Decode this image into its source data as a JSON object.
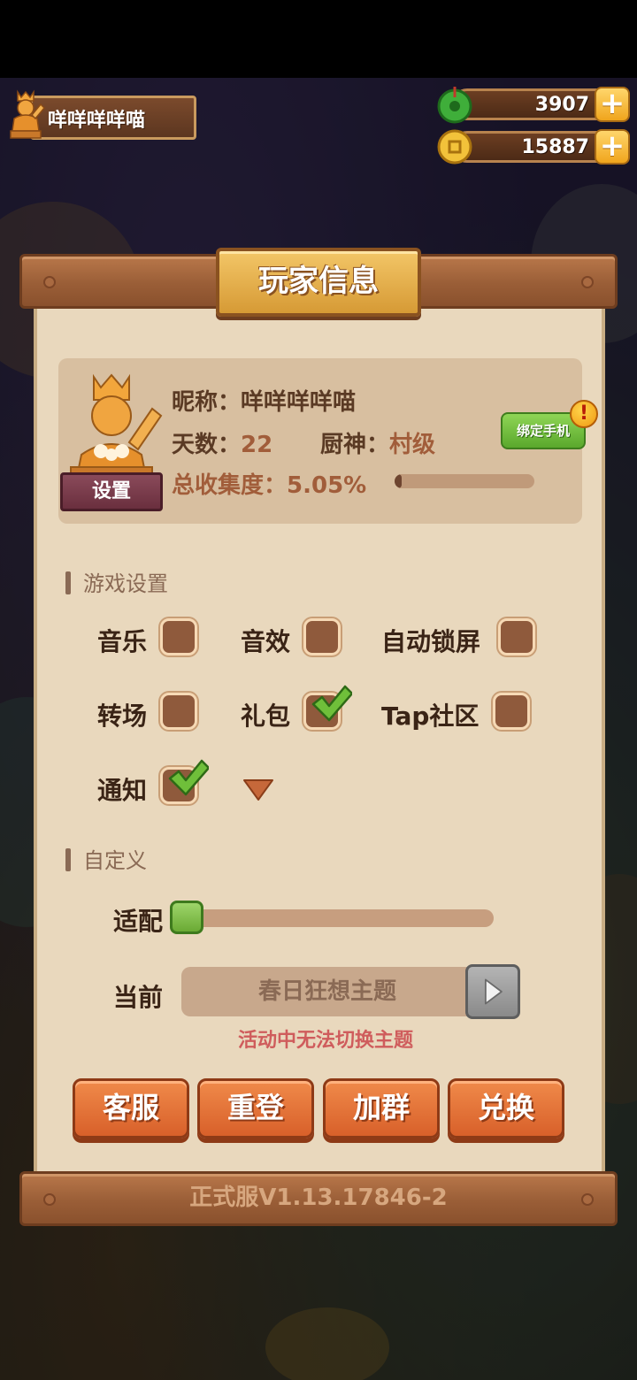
{
  "player": {
    "name": "咩咩咩咩喵"
  },
  "currency": {
    "jade": {
      "value": "3907",
      "icon": "jade-icon",
      "color": "#3fae3a"
    },
    "coins": {
      "value": "15887",
      "icon": "coin-icon",
      "color": "#f2c23a"
    }
  },
  "dialog": {
    "title": "玩家信息",
    "profile": {
      "nickname_label": "昵称：",
      "nickname": "咩咩咩咩喵",
      "days_label": "天数：",
      "days": "22",
      "chef_label": "厨神：",
      "chef_rank": "村级",
      "collection_label": "总收集度：",
      "collection": "5.05%",
      "collection_fraction": 0.0505,
      "settings_button": "设置",
      "bind_phone_button": "绑定手机",
      "alert_badge": "!"
    },
    "game_settings": {
      "title": "游戏设置",
      "options": [
        {
          "label": "音乐",
          "checked": false
        },
        {
          "label": "音效",
          "checked": false
        },
        {
          "label": "自动锁屏",
          "checked": false
        },
        {
          "label": "转场",
          "checked": false
        },
        {
          "label": "礼包",
          "checked": true
        },
        {
          "label": "Tap社区",
          "checked": false
        },
        {
          "label": "通知",
          "checked": true
        }
      ]
    },
    "custom": {
      "title": "自定义",
      "fit_label": "适配",
      "fit_fraction": 0.0,
      "current_label": "当前",
      "theme": "春日狂想主题",
      "theme_warning": "活动中无法切换主题"
    },
    "buttons": [
      "客服",
      "重登",
      "加群",
      "兑换"
    ],
    "version": "正式服V1.13.17846-2"
  },
  "colors": {
    "panel": "#e9d8bd",
    "wood": "#9a5e37",
    "accent_orange": "#e2743a",
    "checkbox": "#8f5a3c",
    "check_green": "#6fbf3a",
    "warning": "#cf5c5c"
  }
}
